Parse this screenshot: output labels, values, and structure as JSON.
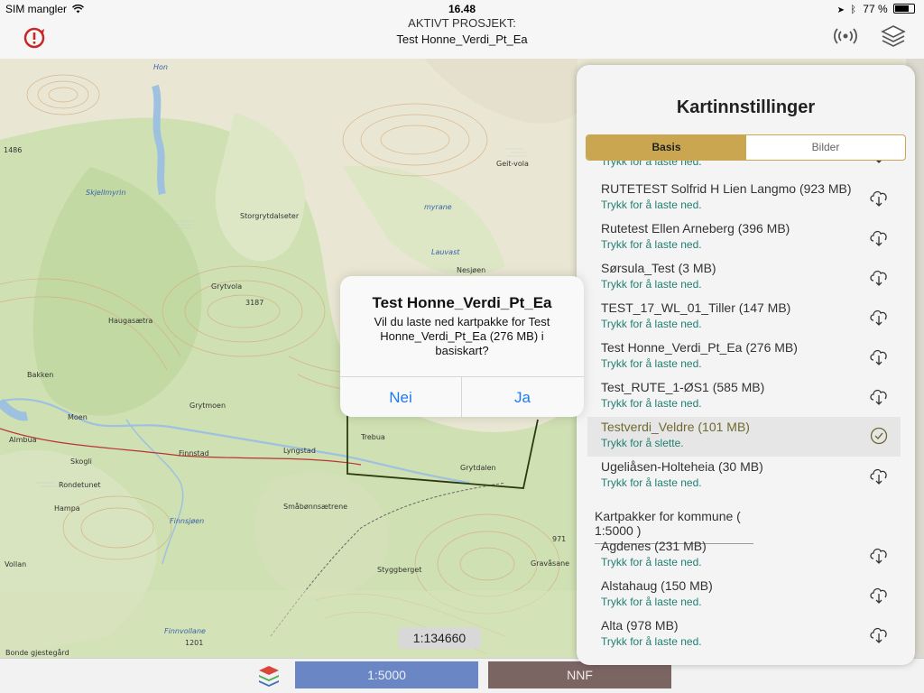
{
  "status_bar": {
    "carrier": "SIM mangler",
    "time": "16.48",
    "battery": "77 %"
  },
  "nav": {
    "title_line1": "AKTIVT PROSJEKT:",
    "title_line2": "Test Honne_Verdi_Pt_Ea",
    "left_icon": "sync-alert-icon",
    "right_icons": [
      "gps-signal-icon",
      "layers-icon"
    ]
  },
  "map": {
    "scale_label": "1:134660",
    "place_labels": [
      "Storgrytdalseter",
      "Grytvola",
      "Haugasætra",
      "Bakken",
      "Moen",
      "Almbua",
      "Skogli",
      "Rondetunet",
      "Hampa",
      "Vollan",
      "Grytmoen",
      "Finnstad",
      "Lyngstad",
      "Trebua",
      "Grytdalen",
      "Småbønnsætrene",
      "Styggberget",
      "Finnvollane",
      "Bonde gjestegård",
      "Skjellmyrin",
      "Finnsjøen",
      "Lauvast",
      "Geit-vola",
      "Gravåsane",
      "myrane",
      "Hon",
      "Nesjøen",
      "1486",
      "3187",
      "1201",
      "971"
    ],
    "accent": "#caa651"
  },
  "bottom_bar": {
    "scale_button": "1:5000",
    "nnf_button": "NNF",
    "layers_icon": "stack-layers-icon",
    "scale_color": "#6b86c4",
    "nnf_color": "#7b6563"
  },
  "panel": {
    "title": "Kartinnstillinger",
    "tabs": [
      "Basis",
      "Bilder"
    ],
    "active_tab": "Basis",
    "partial_first_sub": "Trykk for å laste ned.",
    "rows": [
      {
        "name": "RUTETEST Solfrid H Lien Langmo (923 MB)",
        "sub": "Trykk for å laste ned.",
        "icon": "cloud-download-icon"
      },
      {
        "name": "Rutetest Ellen Arneberg (396 MB)",
        "sub": "Trykk for å laste ned.",
        "icon": "cloud-download-icon"
      },
      {
        "name": "Sørsula_Test (3 MB)",
        "sub": "Trykk for å laste ned.",
        "icon": "cloud-download-icon"
      },
      {
        "name": "TEST_17_WL_01_Tiller (147 MB)",
        "sub": "Trykk for å laste ned.",
        "icon": "cloud-download-icon"
      },
      {
        "name": "Test Honne_Verdi_Pt_Ea (276 MB)",
        "sub": "Trykk for å laste ned.",
        "icon": "cloud-download-icon"
      },
      {
        "name": "Test_RUTE_1-ØS1 (585 MB)",
        "sub": "Trykk for å laste ned.",
        "icon": "cloud-download-icon"
      },
      {
        "name": "Testverdi_Veldre (101 MB)",
        "sub": "Trykk for å slette.",
        "icon": "check-circle-icon",
        "selected": true
      },
      {
        "name": "Ugeliåsen-Holteheia (30 MB)",
        "sub": "Trykk for å laste ned.",
        "icon": "cloud-download-icon"
      }
    ],
    "section_header": "Kartpakker for kommune ( 1:5000 )",
    "kommune_rows": [
      {
        "name": "Agdenes (231 MB)",
        "sub": "Trykk for å laste ned.",
        "icon": "cloud-download-icon"
      },
      {
        "name": "Alstahaug (150 MB)",
        "sub": "Trykk for å laste ned.",
        "icon": "cloud-download-icon"
      },
      {
        "name": "Alta (978 MB)",
        "sub": "Trykk for å laste ned.",
        "icon": "cloud-download-icon"
      }
    ]
  },
  "alert": {
    "title": "Test Honne_Verdi_Pt_Ea",
    "message": "Vil du laste ned kartpakke for Test Honne_Verdi_Pt_Ea (276 MB) i basiskart?",
    "cancel": "Nei",
    "confirm": "Ja"
  }
}
